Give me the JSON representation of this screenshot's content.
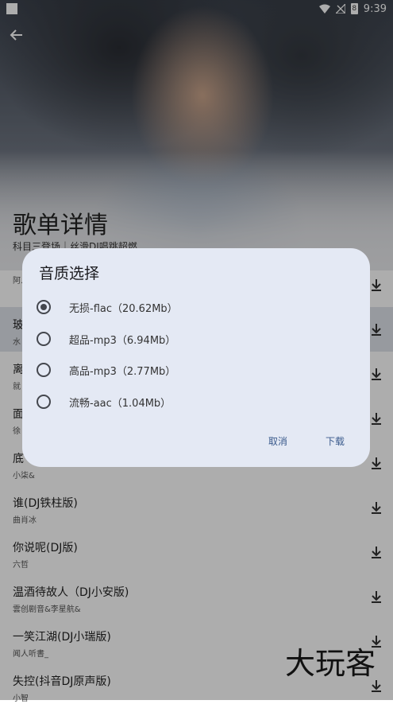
{
  "status_bar": {
    "time": "9:39",
    "battery": "8"
  },
  "header": {
    "title": "歌单详情",
    "subtitle": "科目三登场｜丝滑DJ唱跳超燃"
  },
  "songs": [
    {
      "title": "",
      "artist": "阿.."
    },
    {
      "title": "玻",
      "artist": "水"
    },
    {
      "title": "离",
      "artist": "就"
    },
    {
      "title": "面",
      "artist": "徐"
    },
    {
      "title": "底",
      "artist": "小柒&"
    },
    {
      "title": "谁(DJ铁柱版)",
      "artist": "曲肖冰"
    },
    {
      "title": "你说呢(DJ版)",
      "artist": "六哲"
    },
    {
      "title": "温酒待故人（DJ小安版)",
      "artist": "雲创剧音&李星航&"
    },
    {
      "title": "一笑江湖(DJ小瑞版)",
      "artist": "闻人听書_"
    },
    {
      "title": "失控(抖音DJ原声版)",
      "artist": "小智"
    }
  ],
  "dialog": {
    "title": "音质选择",
    "options": [
      {
        "label": "无损-flac（20.62Mb）",
        "selected": true
      },
      {
        "label": "超品-mp3（6.94Mb）",
        "selected": false
      },
      {
        "label": "高品-mp3（2.77Mb）",
        "selected": false
      },
      {
        "label": "流畅-aac（1.04Mb）",
        "selected": false
      }
    ],
    "cancel": "取消",
    "download": "下载"
  },
  "watermark": "大玩客"
}
